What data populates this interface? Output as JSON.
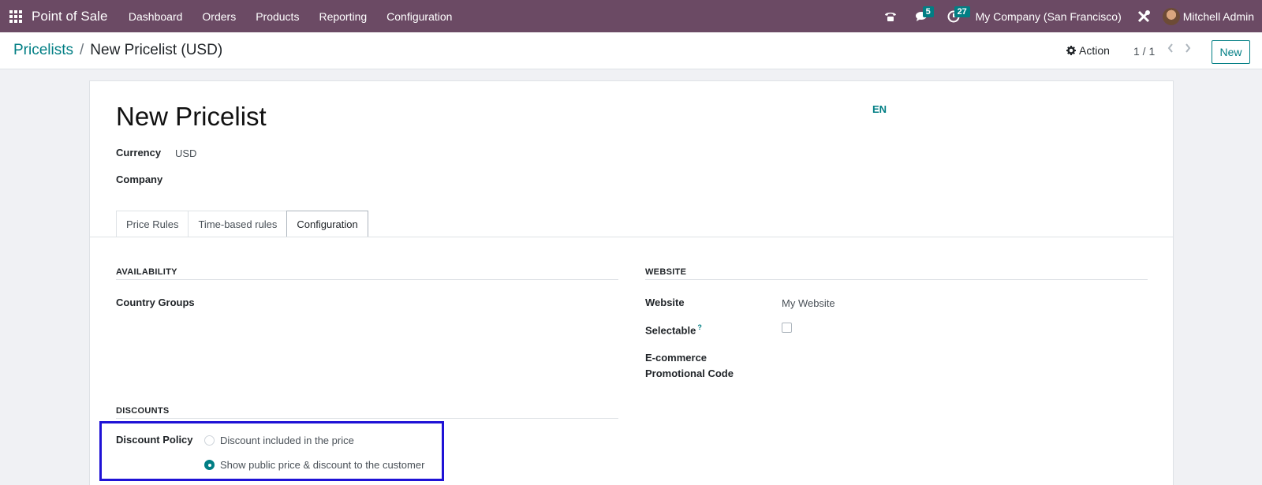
{
  "navbar": {
    "app_name": "Point of Sale",
    "menu": [
      "Dashboard",
      "Orders",
      "Products",
      "Reporting",
      "Configuration"
    ],
    "messages_count": "5",
    "activities_count": "27",
    "company": "My Company (San Francisco)",
    "user": "Mitchell Admin",
    "bg_color": "#6b4a64",
    "badge_color": "#017e84"
  },
  "control_panel": {
    "breadcrumb_parent": "Pricelists",
    "breadcrumb_sep": "/",
    "breadcrumb_current": "New Pricelist (USD)",
    "action_label": "Action",
    "pager": "1 / 1",
    "new_button": "New"
  },
  "form": {
    "title": "New Pricelist",
    "lang_code": "EN",
    "currency_label": "Currency",
    "currency_value": "USD",
    "company_label": "Company",
    "tabs": [
      "Price Rules",
      "Time-based rules",
      "Configuration"
    ],
    "active_tab": "Configuration",
    "availability": {
      "heading": "AVAILABILITY",
      "country_groups_label": "Country Groups"
    },
    "website_section": {
      "heading": "WEBSITE",
      "website_label": "Website",
      "website_value": "My Website",
      "selectable_label": "Selectable",
      "selectable_help": "?",
      "selectable_checked": false,
      "promo_label_line1": "E-commerce",
      "promo_label_line2": "Promotional Code"
    },
    "discounts": {
      "heading": "DISCOUNTS",
      "policy_label": "Discount Policy",
      "options": [
        {
          "label": "Discount included in the price",
          "selected": false
        },
        {
          "label": "Show public price & discount to the customer",
          "selected": true
        }
      ]
    }
  }
}
